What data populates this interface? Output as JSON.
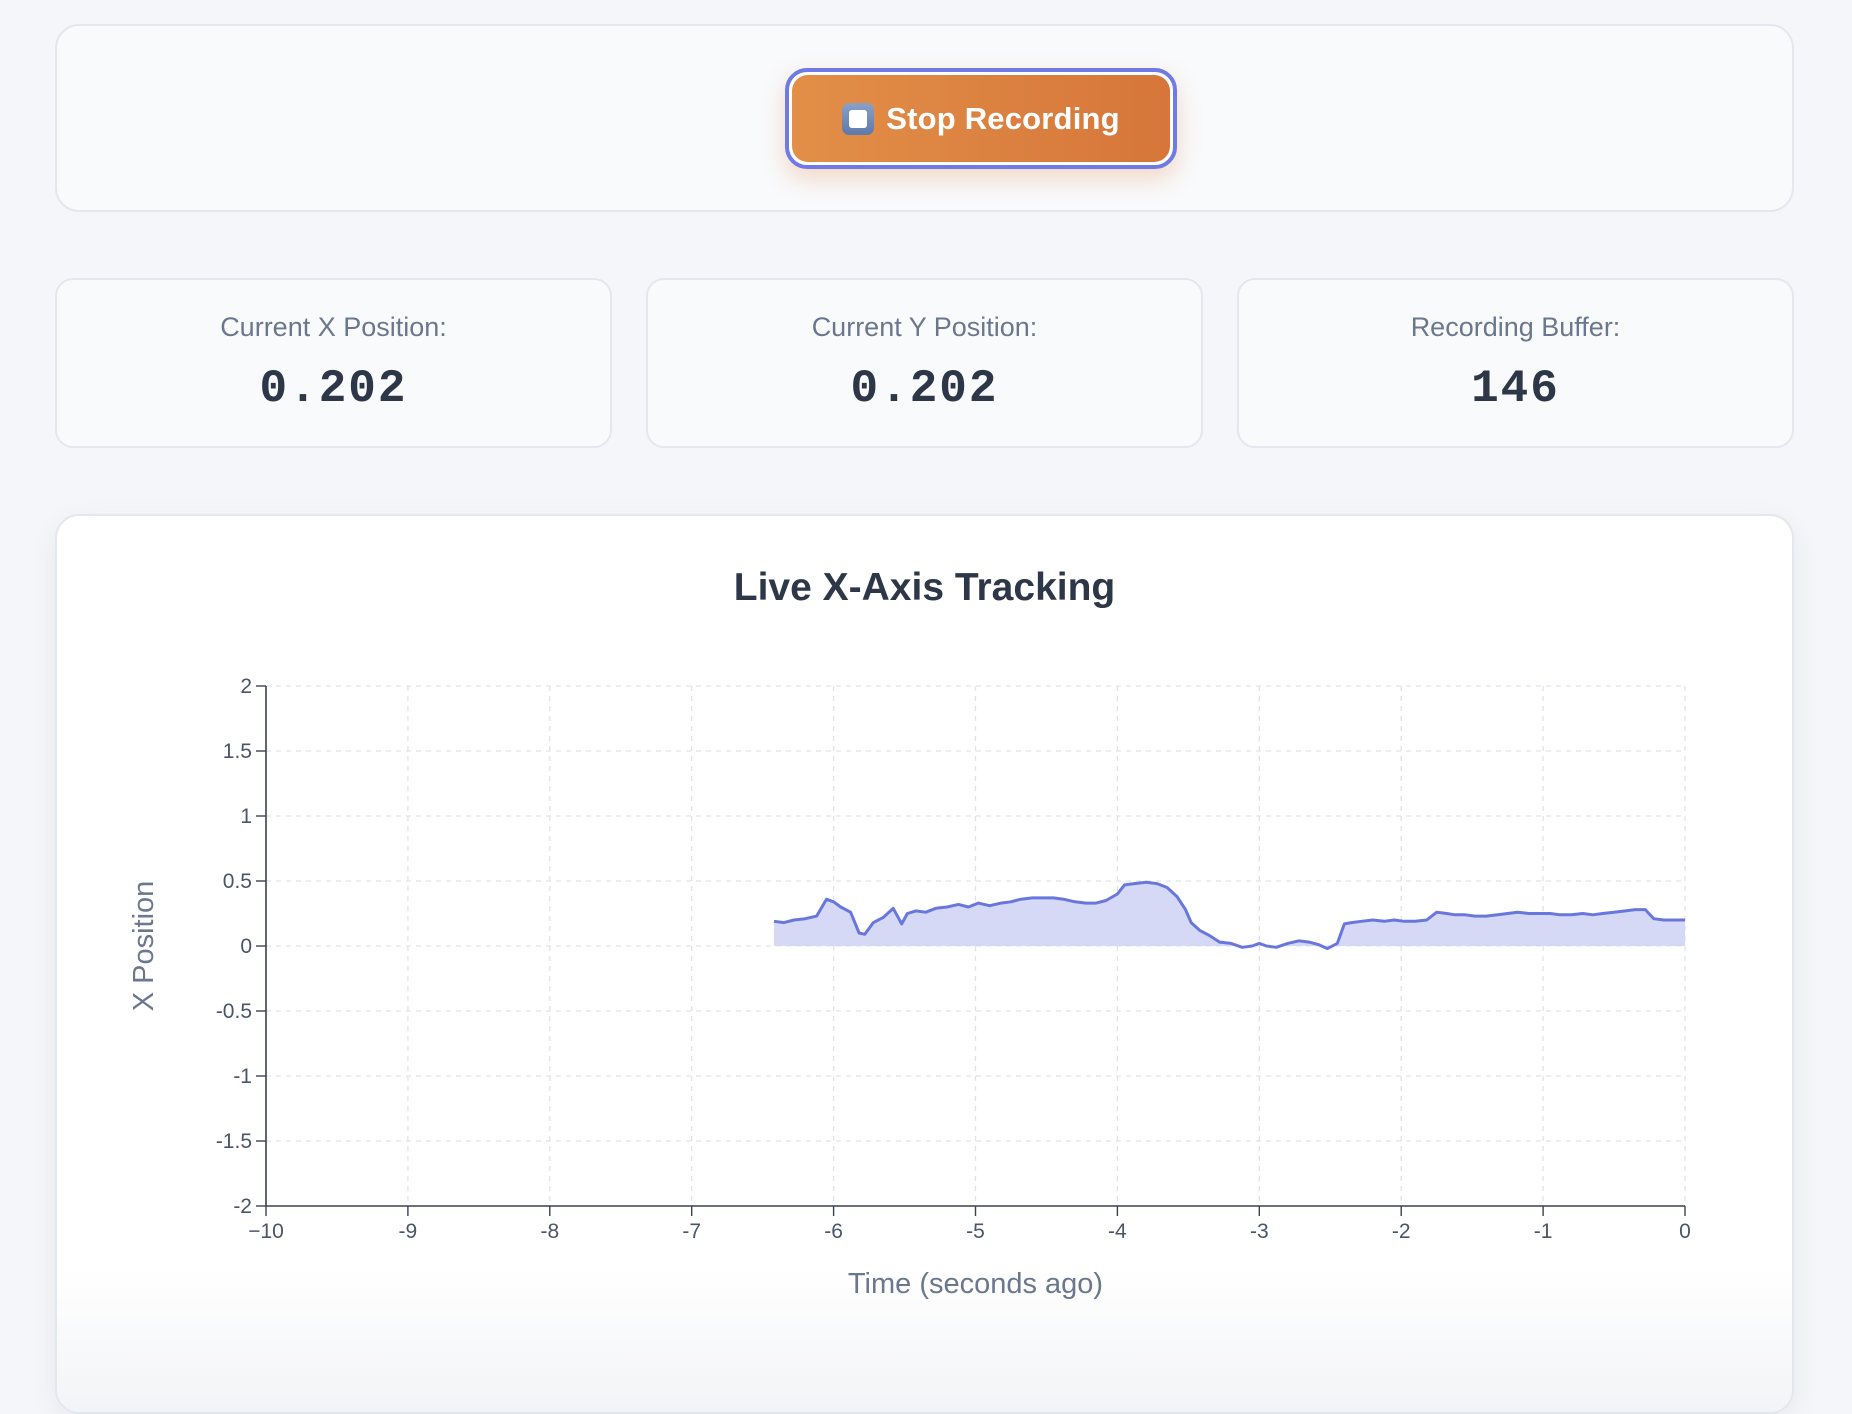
{
  "controls": {
    "record_button_label": "Stop Recording",
    "record_button_icon": "stop-icon"
  },
  "stats": [
    {
      "label": "Current X Position:",
      "value": "0.202"
    },
    {
      "label": "Current Y Position:",
      "value": "0.202"
    },
    {
      "label": "Recording Buffer:",
      "value": "146"
    }
  ],
  "chart_data": {
    "type": "area",
    "title": "Live X-Axis Tracking",
    "xlabel": "Time (seconds ago)",
    "ylabel": "X Position",
    "xlim": [
      -10,
      0
    ],
    "ylim": [
      -2,
      2
    ],
    "x_ticks": [
      -10,
      -9,
      -8,
      -7,
      -6,
      -5,
      -4,
      -3,
      -2,
      -1,
      0
    ],
    "x_tick_labels": [
      "−10",
      "-9",
      "-8",
      "-7",
      "-6",
      "-5",
      "-4",
      "-3",
      "-2",
      "-1",
      "0"
    ],
    "y_ticks": [
      2,
      1.5,
      1,
      0.5,
      0,
      -0.5,
      -1,
      -1.5,
      -2
    ],
    "y_tick_labels": [
      "2",
      "1.5",
      "1",
      "0.5",
      "0",
      "-0.5",
      "-1",
      "-1.5",
      "-2"
    ],
    "grid": true,
    "line_color": "#6977dd",
    "fill_color": "#d3d7f6",
    "series": [
      {
        "x": [
          -6.42,
          -6.35,
          -6.28,
          -6.2,
          -6.12,
          -6.05,
          -6.0,
          -5.95,
          -5.88,
          -5.82,
          -5.78,
          -5.72,
          -5.65,
          -5.58,
          -5.52,
          -5.48,
          -5.42,
          -5.35,
          -5.28,
          -5.2,
          -5.12,
          -5.05,
          -4.98,
          -4.9,
          -4.82,
          -4.75,
          -4.68,
          -4.6,
          -4.52,
          -4.45,
          -4.38,
          -4.3,
          -4.22,
          -4.15,
          -4.08,
          -4.0,
          -3.95,
          -3.88,
          -3.8,
          -3.72,
          -3.65,
          -3.58,
          -3.52,
          -3.48,
          -3.42,
          -3.35,
          -3.28,
          -3.2,
          -3.12,
          -3.05,
          -3.0,
          -2.95,
          -2.88,
          -2.8,
          -2.72,
          -2.65,
          -2.58,
          -2.52,
          -2.45,
          -2.4,
          -2.35,
          -2.28,
          -2.2,
          -2.12,
          -2.05,
          -1.98,
          -1.9,
          -1.82,
          -1.75,
          -1.68,
          -1.62,
          -1.55,
          -1.48,
          -1.4,
          -1.32,
          -1.25,
          -1.18,
          -1.1,
          -1.02,
          -0.95,
          -0.88,
          -0.8,
          -0.72,
          -0.65,
          -0.58,
          -0.5,
          -0.42,
          -0.35,
          -0.28,
          -0.22,
          -0.15,
          -0.08,
          0.0
        ],
        "values": [
          0.19,
          0.18,
          0.2,
          0.21,
          0.23,
          0.36,
          0.34,
          0.3,
          0.26,
          0.1,
          0.09,
          0.18,
          0.22,
          0.29,
          0.17,
          0.25,
          0.27,
          0.26,
          0.29,
          0.3,
          0.32,
          0.3,
          0.33,
          0.31,
          0.33,
          0.34,
          0.36,
          0.37,
          0.37,
          0.37,
          0.36,
          0.34,
          0.33,
          0.33,
          0.35,
          0.4,
          0.47,
          0.48,
          0.49,
          0.48,
          0.45,
          0.38,
          0.28,
          0.18,
          0.12,
          0.08,
          0.03,
          0.02,
          -0.01,
          0.0,
          0.02,
          0.0,
          -0.01,
          0.02,
          0.04,
          0.03,
          0.01,
          -0.02,
          0.02,
          0.17,
          0.18,
          0.19,
          0.2,
          0.19,
          0.2,
          0.19,
          0.19,
          0.2,
          0.26,
          0.25,
          0.24,
          0.24,
          0.23,
          0.23,
          0.24,
          0.25,
          0.26,
          0.25,
          0.25,
          0.25,
          0.24,
          0.24,
          0.25,
          0.24,
          0.25,
          0.26,
          0.27,
          0.28,
          0.28,
          0.21,
          0.2,
          0.2,
          0.2
        ]
      }
    ]
  }
}
